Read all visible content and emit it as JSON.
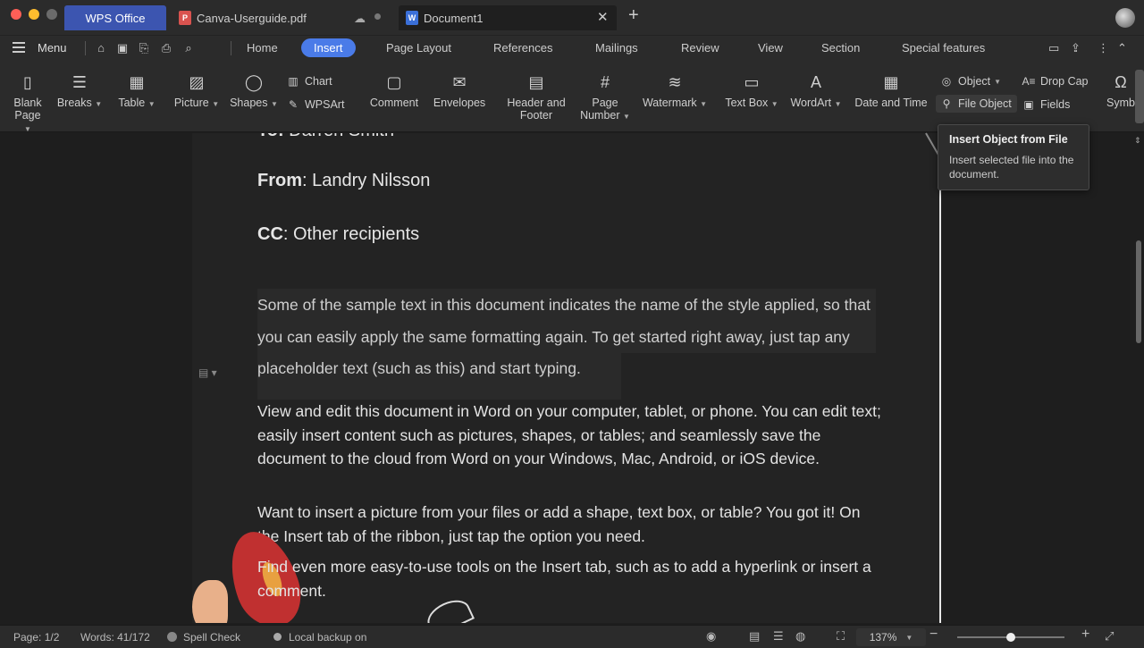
{
  "tabs": {
    "app": "WPS Office",
    "pdf_file": "Canva-Userguide.pdf",
    "doc_file": "Document1"
  },
  "menu": {
    "label": "Menu",
    "tabs": [
      "Home",
      "Insert",
      "Page Layout",
      "References",
      "Mailings",
      "Review",
      "View",
      "Section",
      "Special features"
    ],
    "active_tab": "Insert"
  },
  "ribbon": {
    "blank_page": [
      "Blank",
      "Page"
    ],
    "breaks": "Breaks",
    "table": "Table",
    "picture": "Picture",
    "shapes": "Shapes",
    "chart": "Chart",
    "wpsart": "WPSArt",
    "comment": "Comment",
    "envelopes": "Envelopes",
    "header_footer": [
      "Header and",
      "Footer"
    ],
    "page_number": [
      "Page",
      "Number"
    ],
    "watermark": "Watermark",
    "text_box": "Text Box",
    "wordart": "WordArt",
    "date_time": "Date and Time",
    "object": "Object",
    "file_object": "File Object",
    "drop_cap": "Drop Cap",
    "fields": "Fields",
    "symbol": "Symb"
  },
  "tooltip": {
    "title": "Insert Object from File",
    "body": "Insert selected file into the document."
  },
  "document": {
    "to_line": {
      "label": "To:",
      "value": " Darren Smith"
    },
    "from_line": {
      "label": "From",
      "value": ": Landry Nilsson"
    },
    "cc_line": {
      "label": "CC",
      "value": ": Other recipients"
    },
    "sample_para": "Some of the sample text in this document indicates the name of the style applied, so that you can easily apply the same formatting again. To get started right away, just tap any placeholder text (such as this) and start typing.",
    "para2": "View and edit this document in Word on your computer, tablet, or phone. You can edit text; easily insert content such as pictures, shapes, or tables; and seamlessly save the document to the cloud from Word on your Windows, Mac, Android, or iOS device.",
    "para3": "Want to insert a picture from your files or add a shape, text box, or table? You got it! On the Insert tab of the ribbon, just tap the option you need.",
    "para4": "Find even more easy-to-use tools on the Insert tab, such as to add a hyperlink or insert a comment."
  },
  "status": {
    "page": "Page: 1/2",
    "words": "Words: 41/172",
    "spell_check": "Spell Check",
    "backup": "Local backup on",
    "zoom": "137%",
    "zoom_level_fraction": 0.5
  },
  "colors": {
    "accent": "#4a7be8",
    "wps_tab": "#3c55b0",
    "background": "#1e1e1e"
  }
}
